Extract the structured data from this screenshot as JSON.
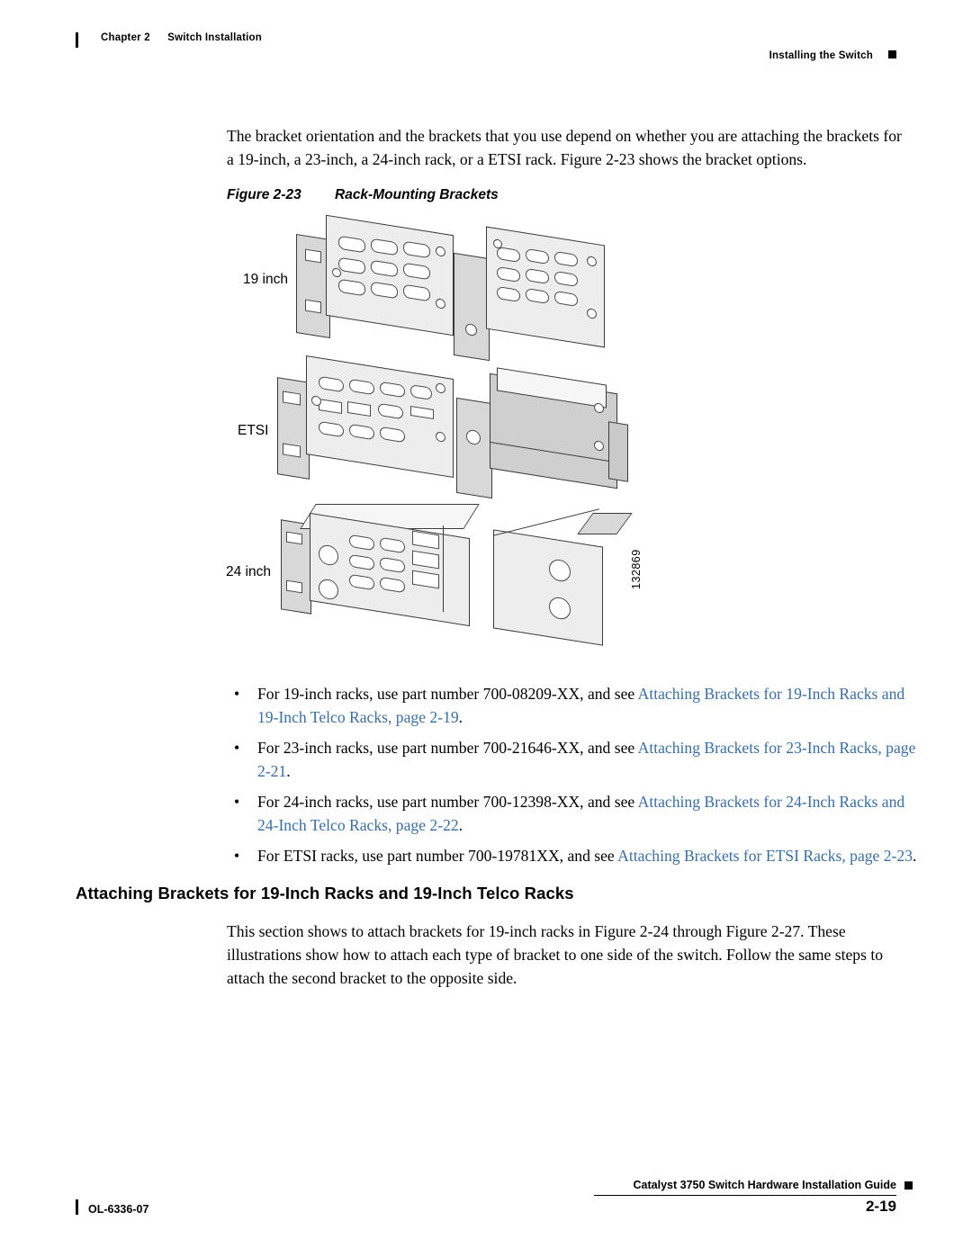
{
  "header": {
    "chapter": "Chapter 2",
    "chapter_title": "Switch Installation",
    "running_head": "Installing the Switch"
  },
  "intro_paragraph": "The bracket orientation and the brackets that you use depend on whether you are attaching the brackets for a 19-inch, a 23-inch, a 24-inch rack, or a ETSI rack. Figure 2-23 shows the bracket options.",
  "figure": {
    "caption_number": "Figure 2-23",
    "caption_title": "Rack-Mounting Brackets",
    "labels": {
      "l19": "19 inch",
      "etsi": "ETSI",
      "l24": "24 inch"
    },
    "art_id": "132869"
  },
  "bullets": [
    {
      "pre": "For 19-inch racks, use part number 700-08209-XX, and see ",
      "link": "Attaching Brackets for 19-Inch Racks and 19-Inch Telco Racks, page 2-19",
      "post": "."
    },
    {
      "pre": "For 23-inch racks, use part number 700-21646-XX, and see ",
      "link": "Attaching Brackets for 23-Inch Racks, page 2-21",
      "post": "."
    },
    {
      "pre": "For 24-inch racks, use part number 700-12398-XX, and see ",
      "link": "Attaching Brackets for 24-Inch Racks and 24-Inch Telco Racks, page 2-22",
      "post": "."
    },
    {
      "pre": "For ETSI racks, use part number 700-19781XX, and see ",
      "link": "Attaching Brackets for ETSI Racks, page 2-23",
      "post": "."
    }
  ],
  "section_heading": "Attaching Brackets for 19-Inch Racks and 19-Inch Telco Racks",
  "section_paragraph": "This section shows to attach brackets for 19-inch racks in Figure 2-24 through Figure 2-27. These illustrations show how to attach each type of bracket to one side of the switch. Follow the same steps to attach the second bracket to the opposite side.",
  "footer": {
    "guide_title": "Catalyst 3750 Switch Hardware Installation Guide",
    "doc_number": "OL-6336-07",
    "page_number": "2-19"
  },
  "colors": {
    "link": "#3a6ea5",
    "line": "#3a3a3a",
    "plate_light": "#f6f6f6",
    "plate_mid": "#ededed",
    "plate_dark": "#d8d8d8"
  }
}
